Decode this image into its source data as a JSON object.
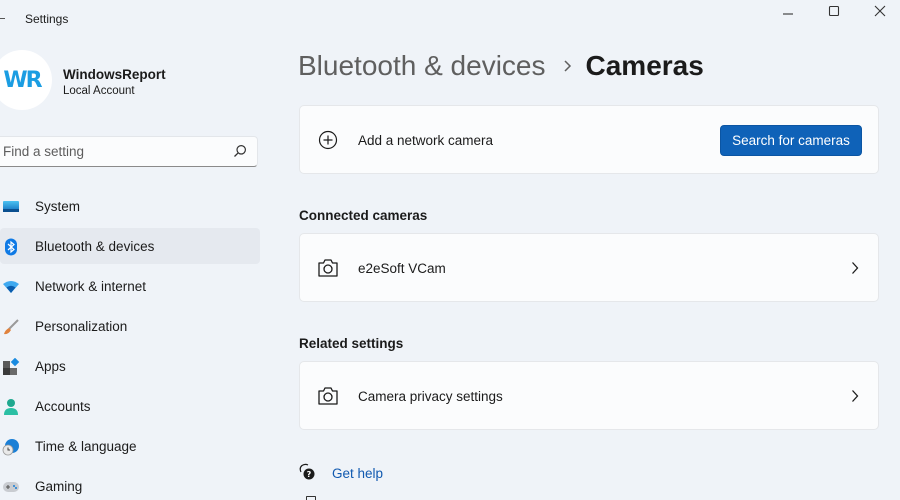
{
  "window": {
    "title": "Settings",
    "controls": {
      "minimize": "minimize",
      "maximize": "maximize",
      "close": "close"
    }
  },
  "profile": {
    "avatar_initials": "WR",
    "name": "WindowsReport",
    "account_type": "Local Account"
  },
  "search": {
    "placeholder": "Find a setting",
    "value": "",
    "icon": "search-icon"
  },
  "sidebar": {
    "items": [
      {
        "label": "System",
        "icon": "system-icon",
        "selected": false
      },
      {
        "label": "Bluetooth & devices",
        "icon": "bluetooth-icon",
        "selected": true
      },
      {
        "label": "Network & internet",
        "icon": "wifi-icon",
        "selected": false
      },
      {
        "label": "Personalization",
        "icon": "brush-icon",
        "selected": false
      },
      {
        "label": "Apps",
        "icon": "apps-icon",
        "selected": false
      },
      {
        "label": "Accounts",
        "icon": "person-icon",
        "selected": false
      },
      {
        "label": "Time & language",
        "icon": "globe-clock-icon",
        "selected": false
      },
      {
        "label": "Gaming",
        "icon": "gamepad-icon",
        "selected": false
      }
    ]
  },
  "breadcrumb": {
    "parent": "Bluetooth & devices",
    "separator": "chevron-right-icon",
    "current": "Cameras"
  },
  "add_camera": {
    "label": "Add a network camera",
    "icon": "add-circle-icon",
    "button_label": "Search for cameras"
  },
  "connected_cameras": {
    "title": "Connected cameras",
    "items": [
      {
        "label": "e2eSoft VCam",
        "icon": "camera-icon"
      }
    ]
  },
  "related_settings": {
    "title": "Related settings",
    "items": [
      {
        "label": "Camera privacy settings",
        "icon": "camera-icon"
      }
    ]
  },
  "help": {
    "get_help_label": "Get help",
    "icon": "help-chat-icon"
  },
  "colors": {
    "accent": "#0f62b8",
    "link": "#1059b0",
    "background": "#eff3f8",
    "card": "#fbfcfd",
    "selected_nav": "#e5e9ef"
  }
}
